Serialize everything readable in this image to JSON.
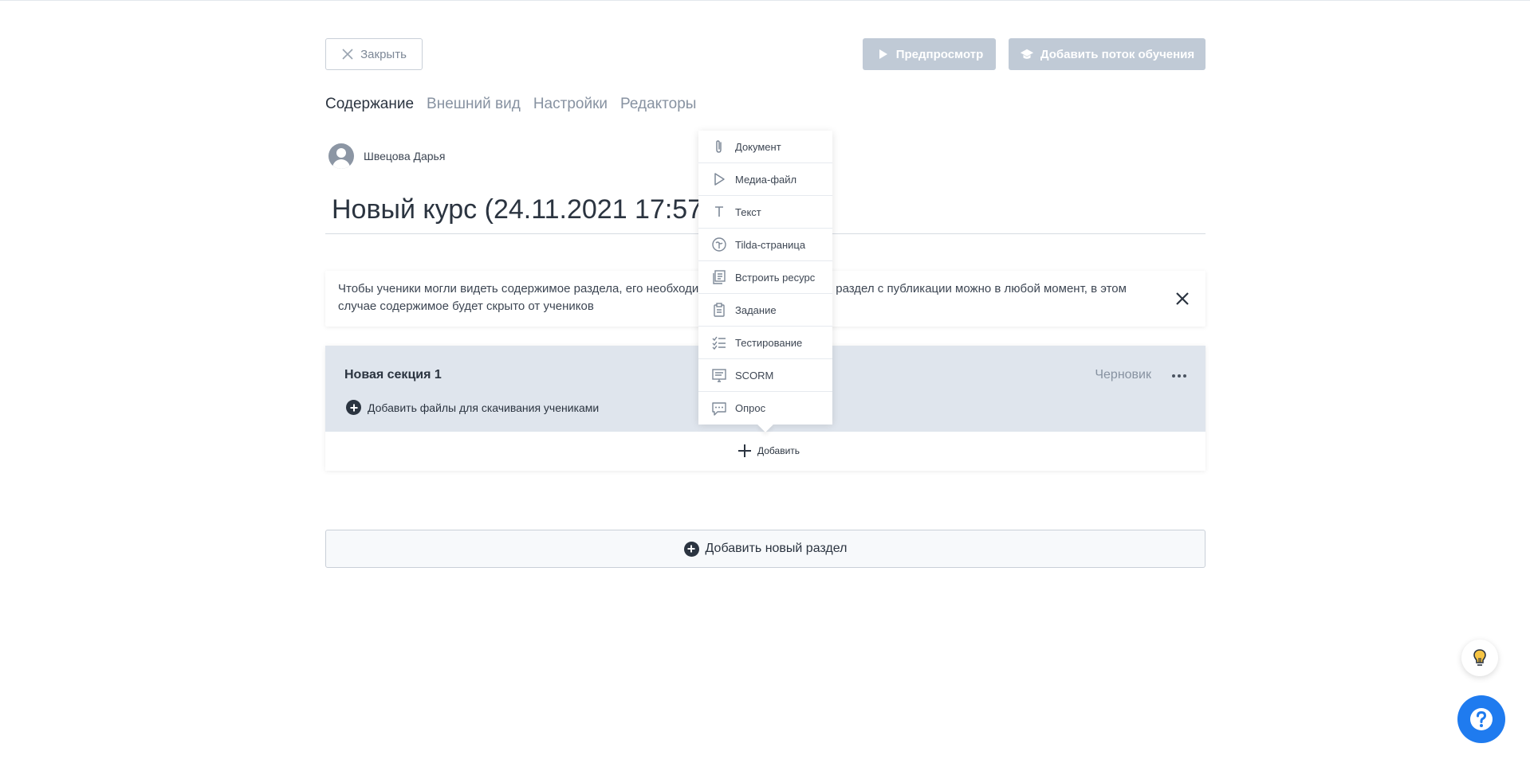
{
  "header": {
    "close_label": "Закрыть",
    "preview_label": "Предпросмотр",
    "add_stream_label": "Добавить поток обучения"
  },
  "tabs": [
    {
      "label": "Содержание",
      "active": true
    },
    {
      "label": "Внешний вид",
      "active": false
    },
    {
      "label": "Настройки",
      "active": false
    },
    {
      "label": "Редакторы",
      "active": false
    }
  ],
  "author": {
    "name": "Швецова Дарья"
  },
  "course": {
    "title": "Новый курс (24.11.2021 17:57:"
  },
  "notice": {
    "text": "Чтобы ученики могли видеть содержимое раздела, его необходимо опубликовать. Снять раздел с публикации можно в любой момент, в этом случае содержимое будет скрыто от учеников"
  },
  "section": {
    "title": "Новая секция 1",
    "status": "Черновик",
    "add_files_label": "Добавить файлы для скачивания учениками",
    "add_label": "Добавить"
  },
  "add_menu": [
    {
      "label": "Документ",
      "icon": "paperclip-icon"
    },
    {
      "label": "Медиа-файл",
      "icon": "play-icon"
    },
    {
      "label": "Текст",
      "icon": "text-icon"
    },
    {
      "label": "Tilda-страница",
      "icon": "tilda-icon"
    },
    {
      "label": "Встроить ресурс",
      "icon": "embed-icon"
    },
    {
      "label": "Задание",
      "icon": "clipboard-icon"
    },
    {
      "label": "Тестирование",
      "icon": "checklist-icon"
    },
    {
      "label": "SCORM",
      "icon": "scorm-icon"
    },
    {
      "label": "Опрос",
      "icon": "chat-icon"
    }
  ],
  "add_section_label": "Добавить новый раздел",
  "colors": {
    "accent": "#1f7bef",
    "disabled_button": "#c0cad6",
    "section_bg": "#dfe5ed"
  }
}
